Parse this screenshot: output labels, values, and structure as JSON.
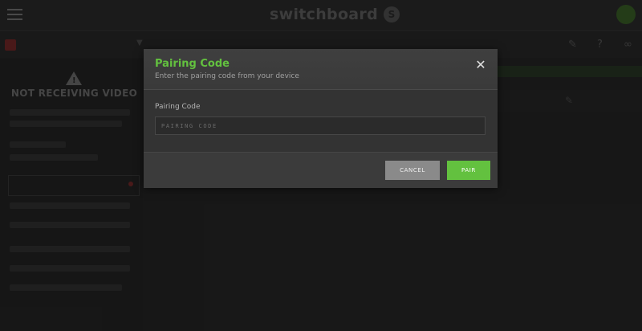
{
  "app": {
    "brand": "switchboard",
    "brand_logo_glyph": "S"
  },
  "modal": {
    "title": "Pairing Code",
    "subtitle": "Enter the pairing code from your device",
    "field_label": "Pairing Code",
    "input_placeholder": "PAIRING CODE",
    "input_value": "",
    "cancel_label": "CANCEL",
    "pair_label": "PAIR",
    "close_glyph": "✕"
  },
  "sidebar": {
    "status_title": "NOT RECEIVING VIDEO"
  },
  "colors": {
    "accent": "#63c13f",
    "cancel_button": "#8a8a8a",
    "modal_bg": "#3b3b3b"
  },
  "icons": [
    "menu-icon",
    "brand-logo-icon",
    "warning-icon",
    "close-icon",
    "pencil-icon",
    "help-icon",
    "link-icon"
  ]
}
